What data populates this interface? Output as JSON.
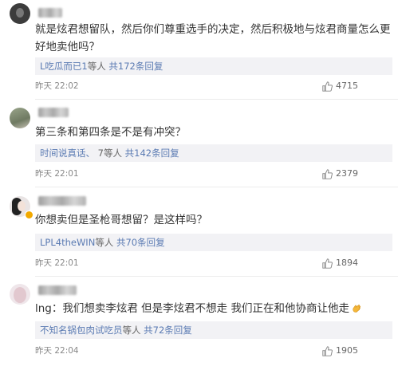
{
  "comments": [
    {
      "text": "就是炫君想留队，然后你们尊重选手的决定，然后积极地与炫君商量怎么更好地卖他吗？",
      "reply_user": "L吃瓜而已1",
      "reply_mid": "等人",
      "reply_count": "共172条回复",
      "time": "昨天 22:02",
      "likes": "4715"
    },
    {
      "text": "第三条和第四条是不是有冲突？",
      "reply_user": "时间说真话、",
      "reply_mid": "7等人",
      "reply_count": "共142条回复",
      "time": "昨天 22:01",
      "likes": "2379"
    },
    {
      "text": "你想卖但是圣枪哥想留？是这样吗？",
      "reply_user": "LPL4theWIN",
      "reply_mid": "等人",
      "reply_count": "共70条回复",
      "time": "昨天 22:01",
      "likes": "1894"
    },
    {
      "text": "lng：我们想卖李炫君 但是李炫君不想走 我们正在和他协商让他走",
      "reply_user": "不知名锅包肉试吃员",
      "reply_mid": "等人",
      "reply_count": "共72条回复",
      "time": "昨天 22:04",
      "likes": "1905"
    }
  ],
  "icons": {
    "like": "thumbs-up-icon",
    "verified": "verified-badge-icon",
    "hand": "clap-hand-icon"
  },
  "colors": {
    "link": "#5b7bb3",
    "reply_bg": "#f2f2f5",
    "badge": "#f2a900"
  }
}
